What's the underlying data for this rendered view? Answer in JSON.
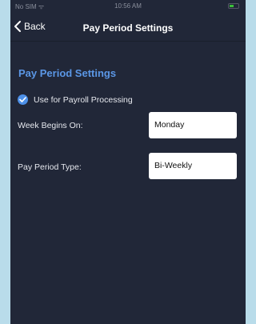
{
  "status_bar": {
    "carrier": "No SIM ᯤ",
    "time": "10:56 AM"
  },
  "nav": {
    "back_label": "Back",
    "title": "Pay Period Settings"
  },
  "section": {
    "title": "Pay Period Settings"
  },
  "payroll_option": {
    "label": "Use for Payroll Processing",
    "checked": true
  },
  "fields": {
    "week_begins": {
      "label": "Week Begins On:",
      "value": "Monday"
    },
    "pay_period_type": {
      "label": "Pay Period Type:",
      "value": "Bi-Weekly"
    }
  },
  "colors": {
    "background": "#212738",
    "accent": "#5b97e6",
    "frame": "#b9dcea"
  }
}
